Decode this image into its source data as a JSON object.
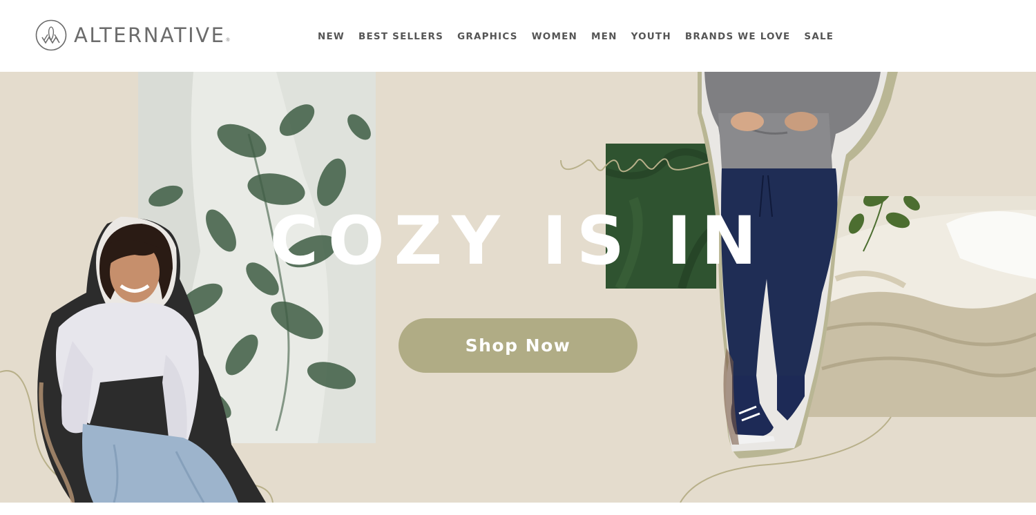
{
  "header": {
    "brand": "ALTERNATIVE",
    "brand_mark": "®",
    "logo_icon": "alternative-monogram-icon",
    "nav": [
      {
        "label": "NEW"
      },
      {
        "label": "BEST SELLERS"
      },
      {
        "label": "GRAPHICS"
      },
      {
        "label": "WOMEN"
      },
      {
        "label": "MEN"
      },
      {
        "label": "YOUTH"
      },
      {
        "label": "BRANDS WE LOVE"
      },
      {
        "label": "SALE"
      }
    ]
  },
  "hero": {
    "headline": "COZY IS IN",
    "cta_label": "Shop Now",
    "colors": {
      "background": "#e4dccd",
      "cta": "#b0ac85",
      "accent_green": "#2f5330",
      "headline": "#ffffff"
    }
  }
}
